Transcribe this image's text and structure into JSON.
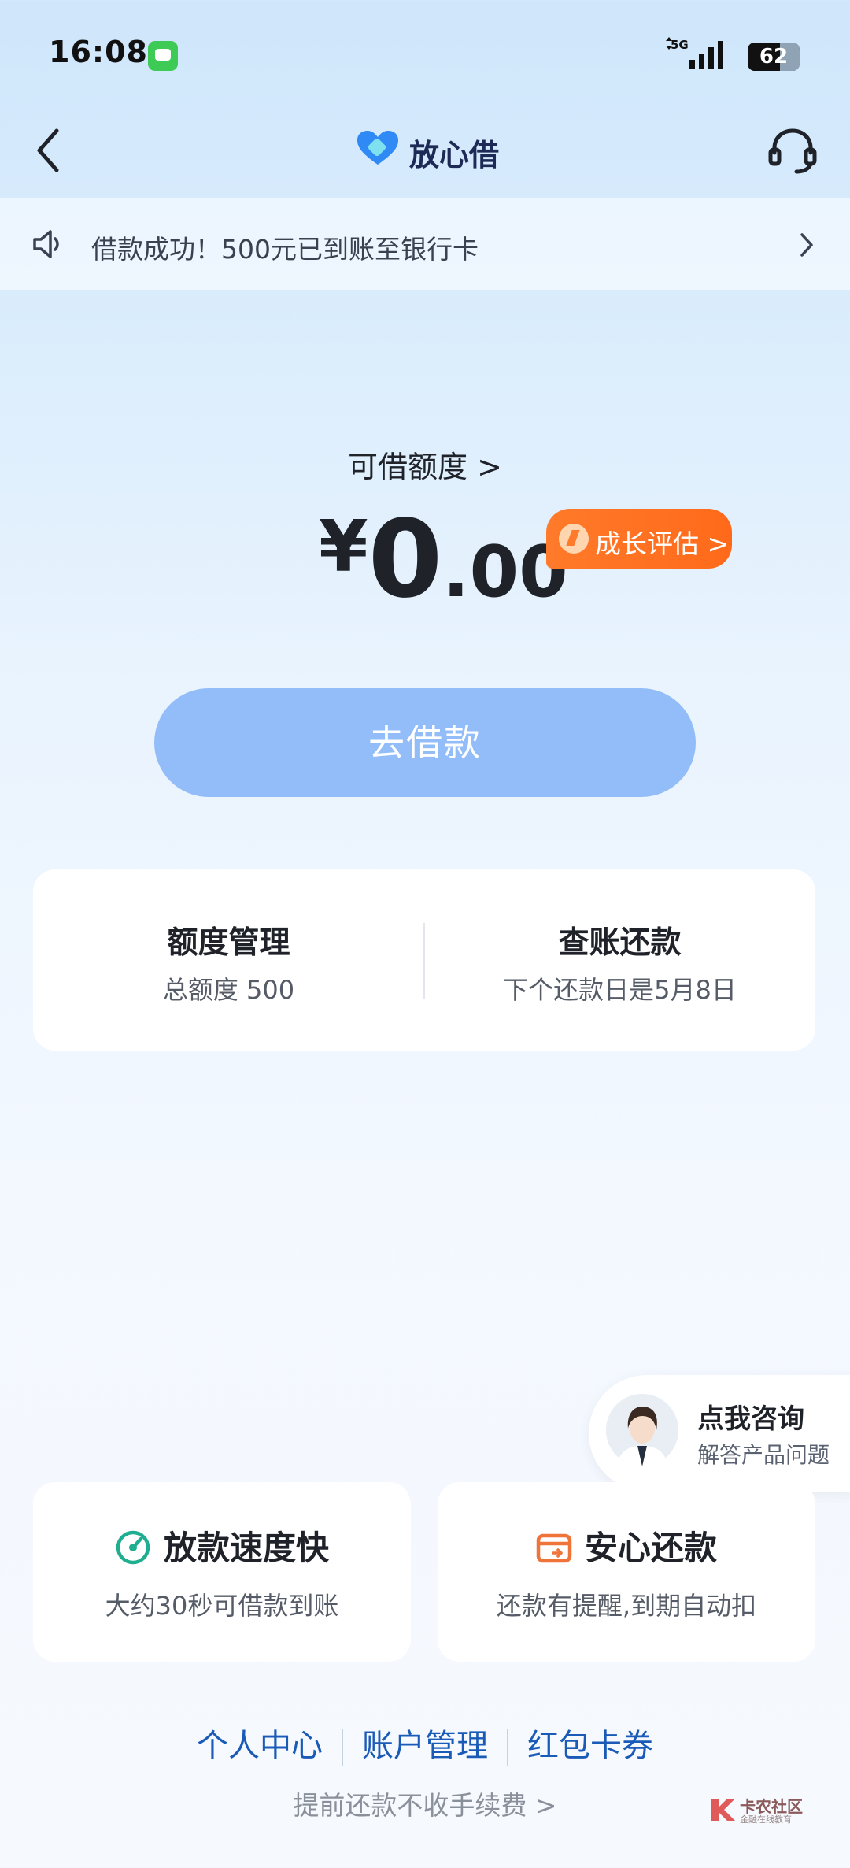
{
  "status_bar": {
    "time": "16:08",
    "network": "5G",
    "battery": "62"
  },
  "nav": {
    "brand": "放心借"
  },
  "notice": {
    "text": "借款成功！500元已到账至银行卡"
  },
  "quota": {
    "label": "可借额度 >",
    "currency": "¥",
    "integer": "0",
    "decimal": ".00",
    "growth_button": "成长评估 >"
  },
  "borrow_button": "去借款",
  "manage": {
    "left_title": "额度管理",
    "left_sub": "总额度 500",
    "right_title": "查账还款",
    "right_sub": "下个还款日是5月8日"
  },
  "consult": {
    "title": "点我咨询",
    "sub": "解答产品问题"
  },
  "features": [
    {
      "title": "放款速度快",
      "sub": "大约30秒可借款到账",
      "icon": "speed-icon"
    },
    {
      "title": "安心还款",
      "sub": "还款有提醒,到期自动扣",
      "icon": "wallet-icon"
    }
  ],
  "links": [
    "个人中心",
    "账户管理",
    "红包卡券"
  ],
  "prepay_text": "提前还款不收手续费 >",
  "watermark": {
    "title": "卡农社区",
    "sub": "金融在线教育"
  },
  "colors": {
    "accent": "#1a5bb8",
    "borrow_button": "#93bdf9",
    "growth_button": "#ff6a1a"
  }
}
